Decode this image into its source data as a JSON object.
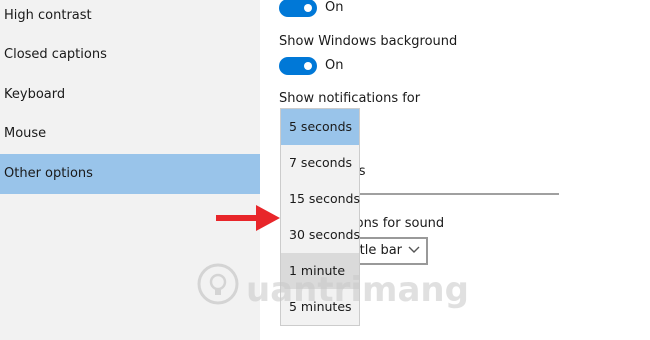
{
  "sidebar": {
    "items": [
      {
        "label": "High contrast"
      },
      {
        "label": "Closed captions"
      },
      {
        "label": "Keyboard"
      },
      {
        "label": "Mouse"
      },
      {
        "label": "Other options",
        "selected": true
      }
    ]
  },
  "main": {
    "top_toggle": {
      "state_label": "On"
    },
    "show_windows_background": {
      "label": "Show Windows background",
      "state_label": "On"
    },
    "show_notifications": {
      "label": "Show notifications for",
      "selected": "5 seconds"
    },
    "partial_label_thickness": "ss",
    "partial_label_sound": "ions for sound",
    "sound_select_partial": "itle bar"
  },
  "dropdown": {
    "options": [
      "5 seconds",
      "7 seconds",
      "15 seconds",
      "30 seconds",
      "1 minute",
      "5 minutes"
    ],
    "selected_index": 0,
    "hover_index": 4
  },
  "watermark": {
    "text": "uantrimang"
  },
  "colors": {
    "accent": "#0078d7",
    "selection": "#99c4ea",
    "sidebar_bg": "#f2f2f2",
    "arrow": "#e8262a"
  },
  "icons": {
    "toggle": "toggle-on-icon",
    "chevron": "chevron-down-icon",
    "arrow": "red-arrow-icon"
  }
}
